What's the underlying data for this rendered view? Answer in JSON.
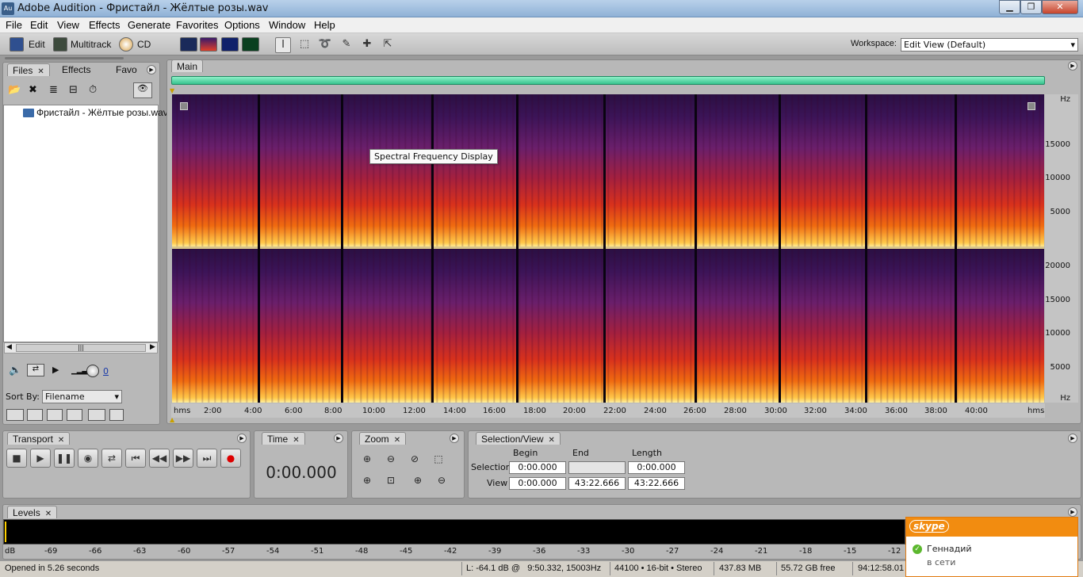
{
  "window": {
    "title": "Adobe Audition - Фристайл - Жёлтые розы.wav",
    "app_icon": "Au"
  },
  "menu": [
    "File",
    "Edit",
    "View",
    "Effects",
    "Generate",
    "Favorites",
    "Options",
    "Window",
    "Help"
  ],
  "toolbar": {
    "edit": "Edit",
    "multitrack": "Multitrack",
    "cd": "CD",
    "workspace_label": "Workspace:",
    "workspace_value": "Edit View (Default)"
  },
  "files_panel": {
    "tabs": [
      "Files",
      "Effects",
      "Favo"
    ],
    "file_name": "Фристайл - Жёлтые розы.wav",
    "sort_label": "Sort By:",
    "sort_value": "Filename",
    "volume_value": "0"
  },
  "main_panel": {
    "tab": "Main",
    "tooltip": "Spectral Frequency Display",
    "hz_unit": "Hz",
    "hz_top": [
      "15000",
      "10000",
      "5000"
    ],
    "hz_bottom": [
      "20000",
      "15000",
      "10000",
      "5000"
    ],
    "time_unit": "hms",
    "time_ticks": [
      "2:00",
      "4:00",
      "6:00",
      "8:00",
      "10:00",
      "12:00",
      "14:00",
      "16:00",
      "18:00",
      "20:00",
      "22:00",
      "24:00",
      "26:00",
      "28:00",
      "30:00",
      "32:00",
      "34:00",
      "36:00",
      "38:00",
      "40:00"
    ]
  },
  "transport": {
    "tab": "Transport"
  },
  "time_panel": {
    "tab": "Time",
    "value": "0:00.000"
  },
  "zoom_panel": {
    "tab": "Zoom"
  },
  "selection_panel": {
    "tab": "Selection/View",
    "cols": [
      "Begin",
      "End",
      "Length"
    ],
    "selection_label": "Selection",
    "view_label": "View",
    "selection": [
      "0:00.000",
      "",
      "0:00.000"
    ],
    "view": [
      "0:00.000",
      "43:22.666",
      "43:22.666"
    ]
  },
  "levels": {
    "tab": "Levels",
    "unit": "dB",
    "ticks": [
      "-69",
      "-66",
      "-63",
      "-60",
      "-57",
      "-54",
      "-51",
      "-48",
      "-45",
      "-42",
      "-39",
      "-36",
      "-33",
      "-30",
      "-27",
      "-24",
      "-21",
      "-18",
      "-15",
      "-12"
    ]
  },
  "skype": {
    "logo": "skype",
    "name": "Геннадий",
    "status": "в сети"
  },
  "status": {
    "message": "Opened in 5.26 seconds",
    "cursor": "L: -64.1 dB @   9:50.332, 15003Hz",
    "format": "44100 • 16-bit • Stereo",
    "size": "437.83 MB",
    "free": "55.72 GB free",
    "time_free": "94:12:58.01"
  }
}
